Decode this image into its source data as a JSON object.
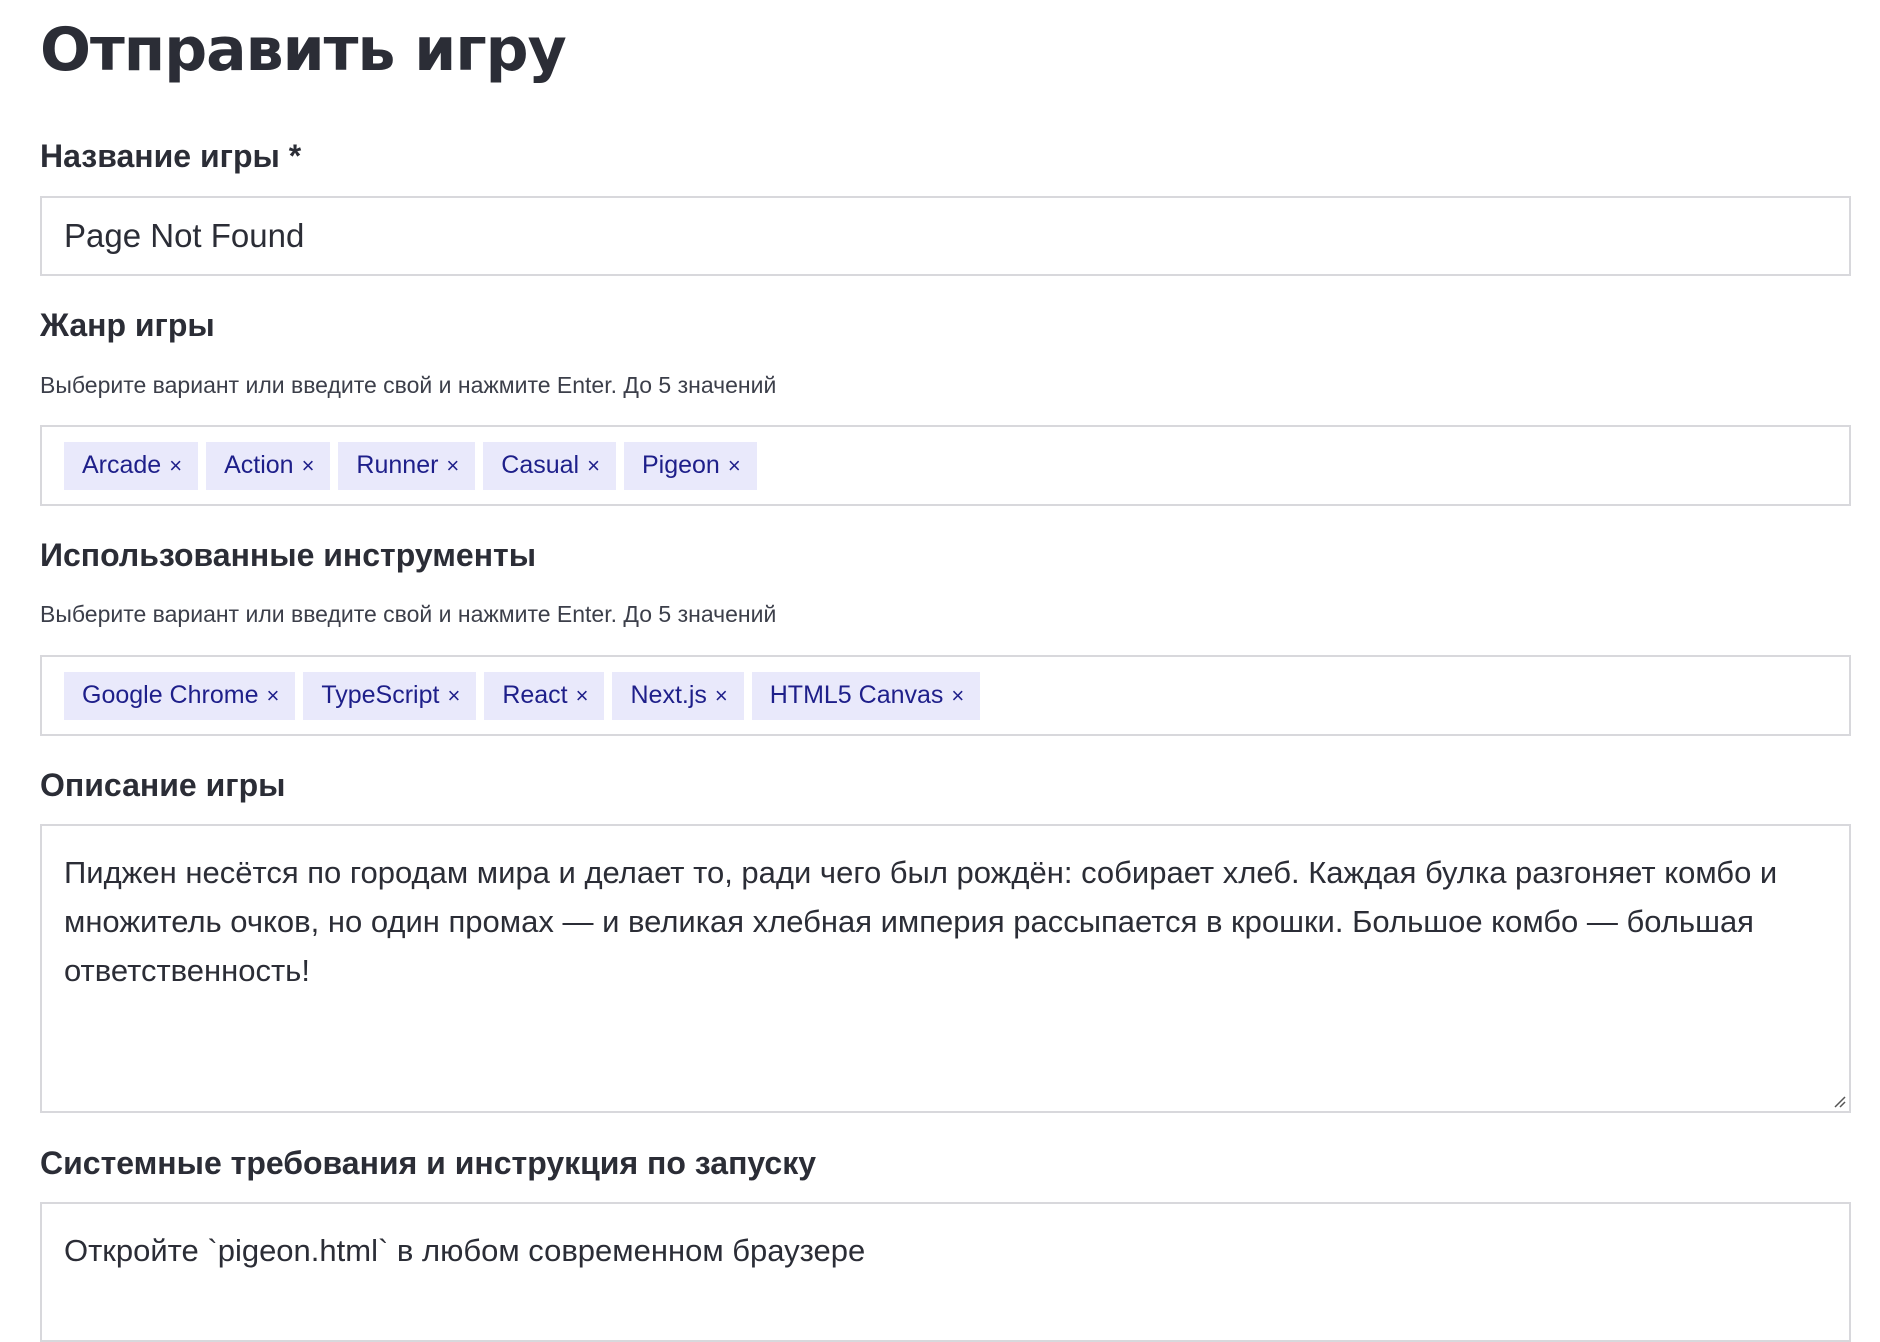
{
  "page": {
    "title": "Отправить игру"
  },
  "form": {
    "name": {
      "label": "Название игры *",
      "value": "Page Not Found"
    },
    "genre": {
      "label": "Жанр игры",
      "hint": "Выберите вариант или введите свой и нажмите Enter. До 5 значений",
      "tags": [
        "Arcade",
        "Action",
        "Runner",
        "Casual",
        "Pigeon"
      ],
      "remove_glyph": "×"
    },
    "tools": {
      "label": "Использованные инструменты",
      "hint": "Выберите вариант или введите свой и нажмите Enter. До 5 значений",
      "tags": [
        "Google Chrome",
        "TypeScript",
        "React",
        "Next.js",
        "HTML5 Canvas"
      ],
      "remove_glyph": "×"
    },
    "description": {
      "label": "Описание игры",
      "value": "Пиджен несётся по городам мира и делает то, ради чего был рождён: собирает хлеб. Каждая булка разгоняет комбо и множитель очков, но один промах — и великая хлебная империя рассыпается в крошки. Большое комбо — большая ответственность!"
    },
    "requirements": {
      "label": "Системные требования и инструкция по запуску",
      "value": "Откройте `pigeon.html` в любом современном браузере"
    }
  },
  "colors": {
    "tag_bg": "#e9e9fb",
    "tag_text": "#1e1f8a",
    "border": "#d8d8dc",
    "text": "#2b2d36"
  }
}
